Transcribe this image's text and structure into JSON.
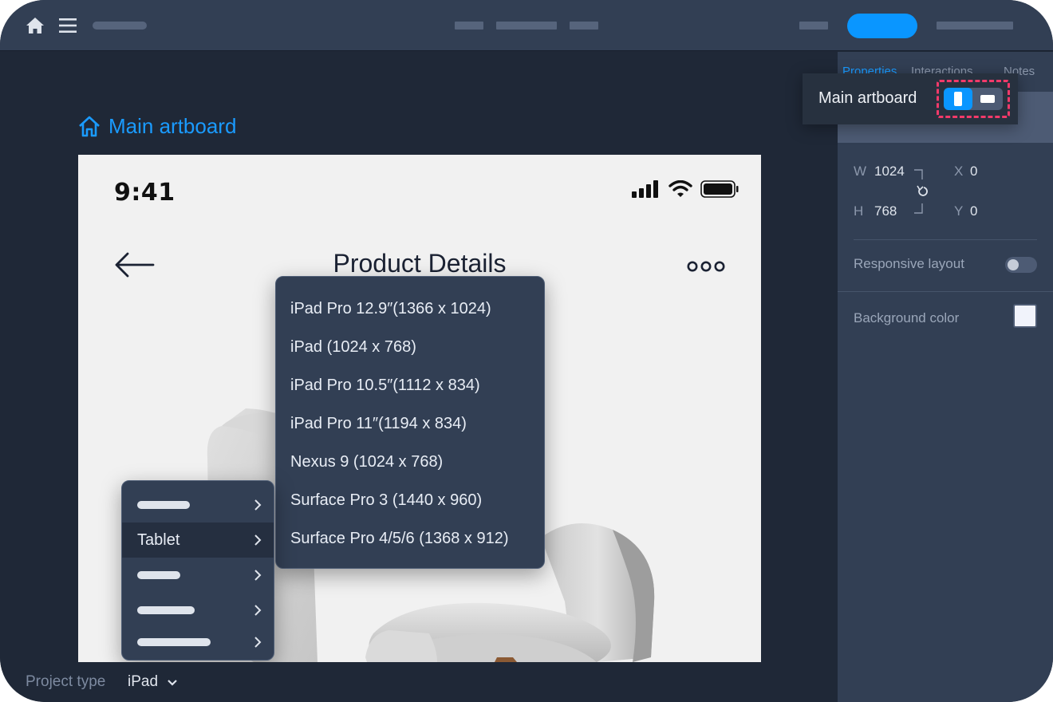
{
  "colors": {
    "accent": "#0a96ff",
    "panel": "#323f54",
    "canvas": "#1f2837",
    "highlight_dash": "#f33a6a"
  },
  "topbar": {
    "home_icon": "home-icon",
    "menu_icon": "hamburger-menu-icon"
  },
  "canvas": {
    "artboard_title": "Main artboard",
    "artboard_icon": "home-outline-icon"
  },
  "device": {
    "status_time": "9:41",
    "status_icons": [
      "cellular-signal-icon",
      "wifi-icon",
      "battery-icon"
    ],
    "nav_title": "Product Details",
    "back_icon": "back-arrow-icon",
    "more_icon": "more-dots-icon"
  },
  "submenu": {
    "items": [
      "iPad Pro 12.9″(1366 x 1024)",
      "iPad (1024 x 768)",
      "iPad Pro 10.5″(1112 x 834)",
      "iPad Pro 11″(1194 x 834)",
      "Nexus 9 (1024 x 768)",
      "Surface Pro 3 (1440 x 960)",
      "Surface Pro 4/5/6 (1368 x 912)"
    ]
  },
  "category_menu": {
    "active_label": "Tablet"
  },
  "bottombar": {
    "project_type_label": "Project type",
    "project_type_value": "iPad"
  },
  "panel": {
    "tabs": [
      "Properties",
      "Interactions",
      "Notes"
    ],
    "w_label": "W",
    "w_value": "1024",
    "h_label": "H",
    "h_value": "768",
    "x_label": "X",
    "x_value": "0",
    "y_label": "Y",
    "y_value": "0",
    "responsive_label": "Responsive layout",
    "responsive_on": false,
    "background_label": "Background color",
    "background_color": "#f1f3fb"
  },
  "popover": {
    "label": "Main artboard",
    "orientation_selected": "portrait"
  }
}
